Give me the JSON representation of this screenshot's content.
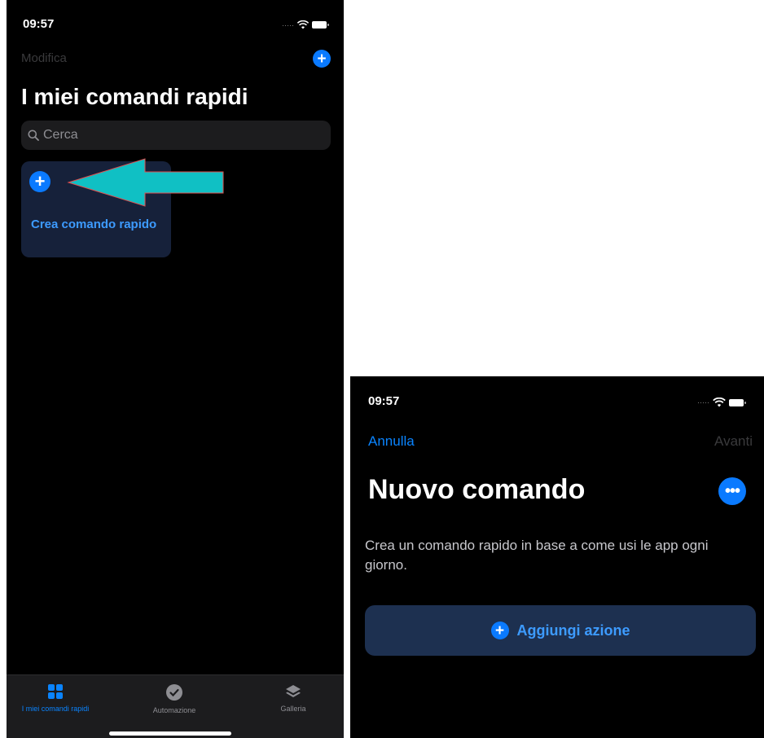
{
  "screen1": {
    "status_time": "09:57",
    "edit_label": "Modifica",
    "title": "I miei comandi rapidi",
    "search_placeholder": "Cerca",
    "create_card_label": "Crea comando rapido",
    "tabs": [
      {
        "label": "I miei comandi rapidi",
        "icon": "grid-icon",
        "active": true
      },
      {
        "label": "Automazione",
        "icon": "automation-icon",
        "active": false
      },
      {
        "label": "Galleria",
        "icon": "gallery-layers-icon",
        "active": false
      }
    ]
  },
  "screen2": {
    "status_time": "09:57",
    "cancel_label": "Annulla",
    "next_label": "Avanti",
    "title": "Nuovo comando",
    "description": "Crea un comando rapido in base a come usi le app ogni giorno.",
    "add_action_label": "Aggiungi azione"
  },
  "colors": {
    "accent": "#0a7aff",
    "link": "#0a84ff",
    "card_text": "#3d9bff",
    "annotation_arrow": "#10c0c4"
  }
}
